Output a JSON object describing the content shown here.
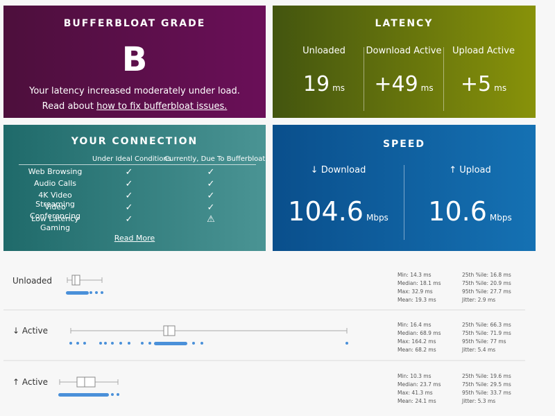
{
  "grade": {
    "title": "BUFFERBLOAT GRADE",
    "letter": "B",
    "line1": "Your latency increased moderately under load.",
    "line2_prefix": "Read about ",
    "line2_link": "how to fix bufferbloat issues."
  },
  "latency": {
    "title": "LATENCY",
    "items": [
      {
        "label": "Unloaded",
        "value": "19",
        "unit": "ms"
      },
      {
        "label": "Download Active",
        "value": "+49",
        "unit": "ms"
      },
      {
        "label": "Upload Active",
        "value": "+5",
        "unit": "ms"
      }
    ]
  },
  "connection": {
    "title": "YOUR CONNECTION",
    "col1": "Under Ideal Conditions",
    "col2": "Currently, Due To Bufferbloat",
    "rows": [
      {
        "name": "Web Browsing",
        "ideal": "✓",
        "current": "✓"
      },
      {
        "name": "Audio Calls",
        "ideal": "✓",
        "current": "✓"
      },
      {
        "name": "4K Video Streaming",
        "ideal": "✓",
        "current": "✓"
      },
      {
        "name": "Video Conferencing",
        "ideal": "✓",
        "current": "✓"
      },
      {
        "name": "Low Latency Gaming",
        "ideal": "✓",
        "current": "⚠"
      }
    ],
    "read_more": "Read More"
  },
  "speed": {
    "title": "SPEED",
    "download_label": "↓ Download",
    "download_value": "104.6",
    "upload_label": "↑ Upload",
    "upload_value": "10.6",
    "unit": "Mbps"
  },
  "stats_rows": [
    {
      "label": "Unloaded",
      "left": [
        "Min: 14.3 ms",
        "Median: 18.1 ms",
        "Max: 32.9 ms",
        "Mean: 19.3 ms"
      ],
      "right": [
        "25th %ile: 16.8 ms",
        "75th %ile: 20.9 ms",
        "95th %ile: 27.7 ms",
        "Jitter: 2.9 ms"
      ]
    },
    {
      "label": "↓ Active",
      "left": [
        "Min: 16.4 ms",
        "Median: 68.9 ms",
        "Max: 164.2 ms",
        "Mean: 68.2 ms"
      ],
      "right": [
        "25th %ile: 66.3 ms",
        "75th %ile: 71.9 ms",
        "95th %ile: 77 ms",
        "Jitter: 5.4 ms"
      ]
    },
    {
      "label": "↑ Active",
      "left": [
        "Min: 10.3 ms",
        "Median: 23.7 ms",
        "Max: 41.3 ms",
        "Mean: 24.1 ms"
      ],
      "right": [
        "25th %ile: 19.6 ms",
        "75th %ile: 29.5 ms",
        "95th %ile: 33.7 ms",
        "Jitter: 5.3 ms"
      ]
    }
  ],
  "colors": {
    "grade_bg": "#5c0f4b",
    "latency_bg": "#6b760c",
    "connection_bg": "#337f7f",
    "speed_bg": "#0e5f9f",
    "dot_color": "#4a90d9"
  }
}
